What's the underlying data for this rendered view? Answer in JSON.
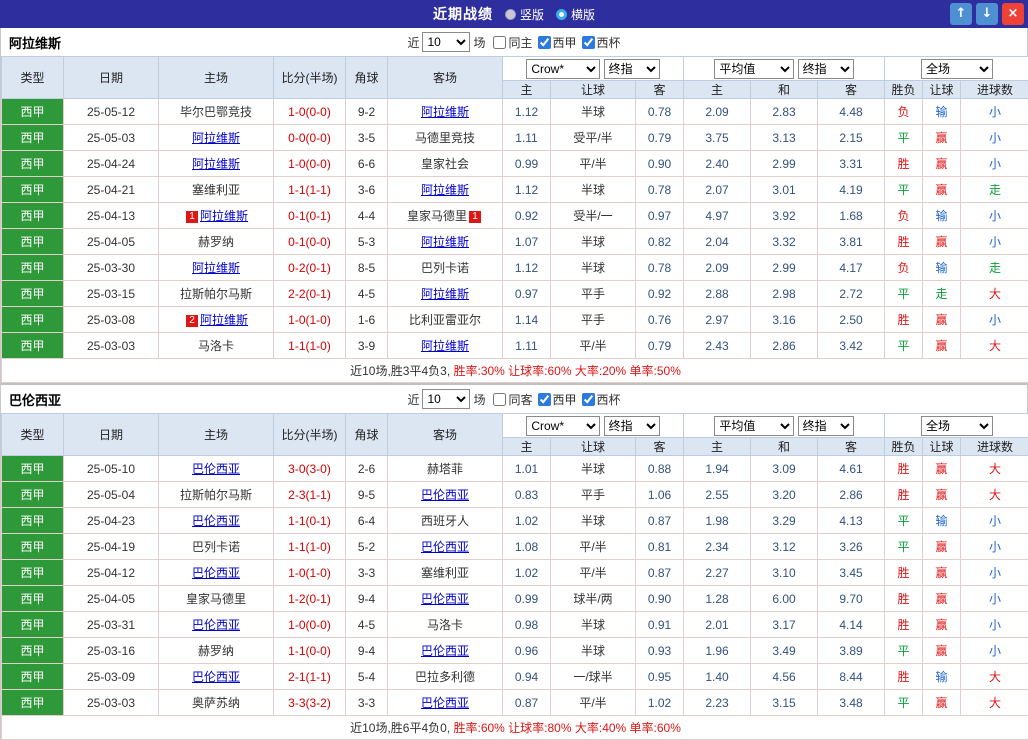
{
  "topbar": {
    "title": "近期战绩",
    "layout_options": [
      {
        "label": "竖版",
        "selected": false
      },
      {
        "label": "横版",
        "selected": true
      }
    ],
    "buttons": {
      "up": "↑",
      "down": "↓",
      "close": "×"
    }
  },
  "headers": {
    "left": [
      "类型",
      "日期",
      "主场",
      "比分(半场)",
      "角球",
      "客场"
    ],
    "asia": [
      "主",
      "让球",
      "客"
    ],
    "europe": [
      "主",
      "和",
      "客"
    ],
    "result": [
      "胜负",
      "让球",
      "进球数"
    ]
  },
  "sections": [
    {
      "team": "阿拉维斯",
      "controls": {
        "near": "近",
        "matches": "10",
        "games": "场",
        "venue": {
          "label": "同主",
          "checked": false
        },
        "league": {
          "label": "西甲",
          "checked": true
        },
        "cup": {
          "label": "西杯",
          "checked": true
        }
      },
      "dropdowns": {
        "company": "Crow*",
        "asia_time": "终指",
        "average": "平均值",
        "europe_time": "终指",
        "scope": "全场"
      },
      "rows": [
        {
          "league": "西甲",
          "date": "25-05-12",
          "home": {
            "name": "毕尔巴鄂竞技",
            "focus": false
          },
          "score": "1-0(0-0)",
          "corner": "9-2",
          "away": {
            "name": "阿拉维斯",
            "focus": true
          },
          "asia": [
            "1.12",
            "半球",
            "0.78"
          ],
          "europe": [
            "2.09",
            "2.83",
            "4.48"
          ],
          "outcome": [
            "负",
            "red"
          ],
          "cover": [
            "输",
            "blue"
          ],
          "goals": [
            "小",
            "blue"
          ]
        },
        {
          "league": "西甲",
          "date": "25-05-03",
          "home": {
            "name": "阿拉维斯",
            "focus": true
          },
          "score": "0-0(0-0)",
          "corner": "3-5",
          "away": {
            "name": "马德里竞技",
            "focus": false
          },
          "asia": [
            "1.11",
            "受平/半",
            "0.79"
          ],
          "europe": [
            "3.75",
            "3.13",
            "2.15"
          ],
          "outcome": [
            "平",
            "green"
          ],
          "cover": [
            "赢",
            "red"
          ],
          "goals": [
            "小",
            "blue"
          ]
        },
        {
          "league": "西甲",
          "date": "25-04-24",
          "home": {
            "name": "阿拉维斯",
            "focus": true
          },
          "score": "1-0(0-0)",
          "corner": "6-6",
          "away": {
            "name": "皇家社会",
            "focus": false
          },
          "asia": [
            "0.99",
            "平/半",
            "0.90"
          ],
          "europe": [
            "2.40",
            "2.99",
            "3.31"
          ],
          "outcome": [
            "胜",
            "red"
          ],
          "cover": [
            "赢",
            "red"
          ],
          "goals": [
            "小",
            "blue"
          ]
        },
        {
          "league": "西甲",
          "date": "25-04-21",
          "home": {
            "name": "塞维利亚",
            "focus": false
          },
          "score": "1-1(1-1)",
          "corner": "3-6",
          "away": {
            "name": "阿拉维斯",
            "focus": true
          },
          "asia": [
            "1.12",
            "半球",
            "0.78"
          ],
          "europe": [
            "2.07",
            "3.01",
            "4.19"
          ],
          "outcome": [
            "平",
            "green"
          ],
          "cover": [
            "赢",
            "red"
          ],
          "goals": [
            "走",
            "green"
          ]
        },
        {
          "league": "西甲",
          "date": "25-04-13",
          "home": {
            "name": "阿拉维斯",
            "focus": true,
            "badge": "1",
            "badge_pos": "before"
          },
          "score": "0-1(0-1)",
          "corner": "4-4",
          "away": {
            "name": "皇家马德里",
            "focus": false,
            "badge": "1",
            "badge_pos": "after"
          },
          "asia": [
            "0.92",
            "受半/一",
            "0.97"
          ],
          "europe": [
            "4.97",
            "3.92",
            "1.68"
          ],
          "outcome": [
            "负",
            "red"
          ],
          "cover": [
            "输",
            "blue"
          ],
          "goals": [
            "小",
            "blue"
          ]
        },
        {
          "league": "西甲",
          "date": "25-04-05",
          "home": {
            "name": "赫罗纳",
            "focus": false
          },
          "score": "0-1(0-0)",
          "corner": "5-3",
          "away": {
            "name": "阿拉维斯",
            "focus": true
          },
          "asia": [
            "1.07",
            "半球",
            "0.82"
          ],
          "europe": [
            "2.04",
            "3.32",
            "3.81"
          ],
          "outcome": [
            "胜",
            "red"
          ],
          "cover": [
            "赢",
            "red"
          ],
          "goals": [
            "小",
            "blue"
          ]
        },
        {
          "league": "西甲",
          "date": "25-03-30",
          "home": {
            "name": "阿拉维斯",
            "focus": true
          },
          "score": "0-2(0-1)",
          "corner": "8-5",
          "away": {
            "name": "巴列卡诺",
            "focus": false
          },
          "asia": [
            "1.12",
            "半球",
            "0.78"
          ],
          "europe": [
            "2.09",
            "2.99",
            "4.17"
          ],
          "outcome": [
            "负",
            "red"
          ],
          "cover": [
            "输",
            "blue"
          ],
          "goals": [
            "走",
            "green"
          ]
        },
        {
          "league": "西甲",
          "date": "25-03-15",
          "home": {
            "name": "拉斯帕尔马斯",
            "focus": false
          },
          "score": "2-2(0-1)",
          "corner": "4-5",
          "away": {
            "name": "阿拉维斯",
            "focus": true
          },
          "asia": [
            "0.97",
            "平手",
            "0.92"
          ],
          "europe": [
            "2.88",
            "2.98",
            "2.72"
          ],
          "outcome": [
            "平",
            "green"
          ],
          "cover": [
            "走",
            "green"
          ],
          "goals": [
            "大",
            "red"
          ]
        },
        {
          "league": "西甲",
          "date": "25-03-08",
          "home": {
            "name": "阿拉维斯",
            "focus": true,
            "badge": "2",
            "badge_pos": "before"
          },
          "score": "1-0(1-0)",
          "corner": "1-6",
          "away": {
            "name": "比利亚雷亚尔",
            "focus": false
          },
          "asia": [
            "1.14",
            "平手",
            "0.76"
          ],
          "europe": [
            "2.97",
            "3.16",
            "2.50"
          ],
          "outcome": [
            "胜",
            "red"
          ],
          "cover": [
            "赢",
            "red"
          ],
          "goals": [
            "小",
            "blue"
          ]
        },
        {
          "league": "西甲",
          "date": "25-03-03",
          "home": {
            "name": "马洛卡",
            "focus": false
          },
          "score": "1-1(1-0)",
          "corner": "3-9",
          "away": {
            "name": "阿拉维斯",
            "focus": true
          },
          "asia": [
            "1.11",
            "平/半",
            "0.79"
          ],
          "europe": [
            "2.43",
            "2.86",
            "3.42"
          ],
          "outcome": [
            "平",
            "green"
          ],
          "cover": [
            "赢",
            "red"
          ],
          "goals": [
            "大",
            "red"
          ]
        }
      ],
      "summary": {
        "record": "近10场,胜3平4负3, ",
        "stats": "胜率:30% 让球率:60% 大率:20% 单率:50%"
      }
    },
    {
      "team": "巴伦西亚",
      "controls": {
        "near": "近",
        "matches": "10",
        "games": "场",
        "venue": {
          "label": "同客",
          "checked": false
        },
        "league": {
          "label": "西甲",
          "checked": true
        },
        "cup": {
          "label": "西杯",
          "checked": true
        }
      },
      "dropdowns": {
        "company": "Crow*",
        "asia_time": "终指",
        "average": "平均值",
        "europe_time": "终指",
        "scope": "全场"
      },
      "rows": [
        {
          "league": "西甲",
          "date": "25-05-10",
          "home": {
            "name": "巴伦西亚",
            "focus": true
          },
          "score": "3-0(3-0)",
          "corner": "2-6",
          "away": {
            "name": "赫塔菲",
            "focus": false
          },
          "asia": [
            "1.01",
            "半球",
            "0.88"
          ],
          "europe": [
            "1.94",
            "3.09",
            "4.61"
          ],
          "outcome": [
            "胜",
            "red"
          ],
          "cover": [
            "赢",
            "red"
          ],
          "goals": [
            "大",
            "red"
          ]
        },
        {
          "league": "西甲",
          "date": "25-05-04",
          "home": {
            "name": "拉斯帕尔马斯",
            "focus": false
          },
          "score": "2-3(1-1)",
          "corner": "9-5",
          "away": {
            "name": "巴伦西亚",
            "focus": true
          },
          "asia": [
            "0.83",
            "平手",
            "1.06"
          ],
          "europe": [
            "2.55",
            "3.20",
            "2.86"
          ],
          "outcome": [
            "胜",
            "red"
          ],
          "cover": [
            "赢",
            "red"
          ],
          "goals": [
            "大",
            "red"
          ]
        },
        {
          "league": "西甲",
          "date": "25-04-23",
          "home": {
            "name": "巴伦西亚",
            "focus": true
          },
          "score": "1-1(0-1)",
          "corner": "6-4",
          "away": {
            "name": "西班牙人",
            "focus": false
          },
          "asia": [
            "1.02",
            "半球",
            "0.87"
          ],
          "europe": [
            "1.98",
            "3.29",
            "4.13"
          ],
          "outcome": [
            "平",
            "green"
          ],
          "cover": [
            "输",
            "blue"
          ],
          "goals": [
            "小",
            "blue"
          ]
        },
        {
          "league": "西甲",
          "date": "25-04-19",
          "home": {
            "name": "巴列卡诺",
            "focus": false
          },
          "score": "1-1(1-0)",
          "corner": "5-2",
          "away": {
            "name": "巴伦西亚",
            "focus": true
          },
          "asia": [
            "1.08",
            "平/半",
            "0.81"
          ],
          "europe": [
            "2.34",
            "3.12",
            "3.26"
          ],
          "outcome": [
            "平",
            "green"
          ],
          "cover": [
            "赢",
            "red"
          ],
          "goals": [
            "小",
            "blue"
          ]
        },
        {
          "league": "西甲",
          "date": "25-04-12",
          "home": {
            "name": "巴伦西亚",
            "focus": true
          },
          "score": "1-0(1-0)",
          "corner": "3-3",
          "away": {
            "name": "塞维利亚",
            "focus": false
          },
          "asia": [
            "1.02",
            "平/半",
            "0.87"
          ],
          "europe": [
            "2.27",
            "3.10",
            "3.45"
          ],
          "outcome": [
            "胜",
            "red"
          ],
          "cover": [
            "赢",
            "red"
          ],
          "goals": [
            "小",
            "blue"
          ]
        },
        {
          "league": "西甲",
          "date": "25-04-05",
          "home": {
            "name": "皇家马德里",
            "focus": false
          },
          "score": "1-2(0-1)",
          "corner": "9-4",
          "away": {
            "name": "巴伦西亚",
            "focus": true
          },
          "asia": [
            "0.99",
            "球半/两",
            "0.90"
          ],
          "europe": [
            "1.28",
            "6.00",
            "9.70"
          ],
          "outcome": [
            "胜",
            "red"
          ],
          "cover": [
            "赢",
            "red"
          ],
          "goals": [
            "小",
            "blue"
          ]
        },
        {
          "league": "西甲",
          "date": "25-03-31",
          "home": {
            "name": "巴伦西亚",
            "focus": true
          },
          "score": "1-0(0-0)",
          "corner": "4-5",
          "away": {
            "name": "马洛卡",
            "focus": false
          },
          "asia": [
            "0.98",
            "半球",
            "0.91"
          ],
          "europe": [
            "2.01",
            "3.17",
            "4.14"
          ],
          "outcome": [
            "胜",
            "red"
          ],
          "cover": [
            "赢",
            "red"
          ],
          "goals": [
            "小",
            "blue"
          ]
        },
        {
          "league": "西甲",
          "date": "25-03-16",
          "home": {
            "name": "赫罗纳",
            "focus": false
          },
          "score": "1-1(0-0)",
          "corner": "9-4",
          "away": {
            "name": "巴伦西亚",
            "focus": true
          },
          "asia": [
            "0.96",
            "半球",
            "0.93"
          ],
          "europe": [
            "1.96",
            "3.49",
            "3.89"
          ],
          "outcome": [
            "平",
            "green"
          ],
          "cover": [
            "赢",
            "red"
          ],
          "goals": [
            "小",
            "blue"
          ]
        },
        {
          "league": "西甲",
          "date": "25-03-09",
          "home": {
            "name": "巴伦西亚",
            "focus": true
          },
          "score": "2-1(1-1)",
          "corner": "5-4",
          "away": {
            "name": "巴拉多利德",
            "focus": false
          },
          "asia": [
            "0.94",
            "一/球半",
            "0.95"
          ],
          "europe": [
            "1.40",
            "4.56",
            "8.44"
          ],
          "outcome": [
            "胜",
            "red"
          ],
          "cover": [
            "输",
            "blue"
          ],
          "goals": [
            "大",
            "red"
          ]
        },
        {
          "league": "西甲",
          "date": "25-03-03",
          "home": {
            "name": "奥萨苏纳",
            "focus": false
          },
          "score": "3-3(3-2)",
          "corner": "3-3",
          "away": {
            "name": "巴伦西亚",
            "focus": true
          },
          "asia": [
            "0.87",
            "平/半",
            "1.02"
          ],
          "europe": [
            "2.23",
            "3.15",
            "3.48"
          ],
          "outcome": [
            "平",
            "green"
          ],
          "cover": [
            "赢",
            "red"
          ],
          "goals": [
            "大",
            "red"
          ]
        }
      ],
      "summary": {
        "record": "近10场,胜6平4负0, ",
        "stats": "胜率:60% 让球率:80% 大率:40% 单率:60%"
      }
    }
  ]
}
